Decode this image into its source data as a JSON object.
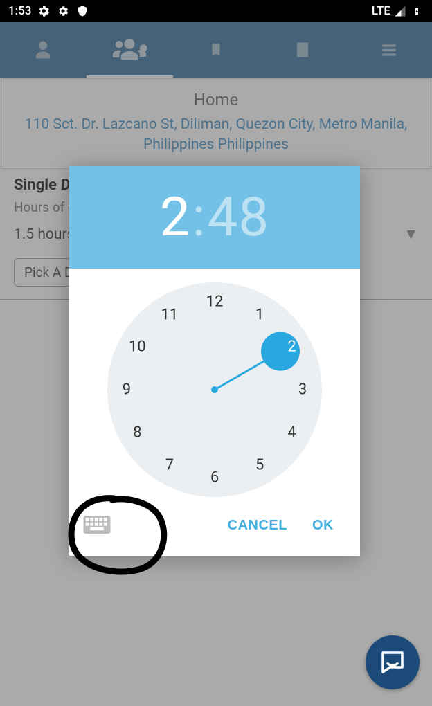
{
  "status": {
    "time": "1:53",
    "network": "LTE"
  },
  "nav": {
    "tabs": [
      "person",
      "group",
      "bookmark",
      "document",
      "menu"
    ]
  },
  "header": {
    "title": "Home",
    "address": "110 Sct. Dr. Lazcano St, Diliman, Quezon City, Metro Manila, Philippines  Philippines"
  },
  "form": {
    "section_label": "Single Day",
    "hours_label": "Hours of cleaning",
    "duration": "1.5 hours",
    "pick_label": "Pick A Date"
  },
  "timepicker": {
    "hour": "2",
    "minute": "48",
    "selected": 2,
    "numbers": [
      "12",
      "1",
      "2",
      "3",
      "4",
      "5",
      "6",
      "7",
      "8",
      "9",
      "10",
      "11"
    ],
    "cancel": "CANCEL",
    "ok": "OK"
  }
}
